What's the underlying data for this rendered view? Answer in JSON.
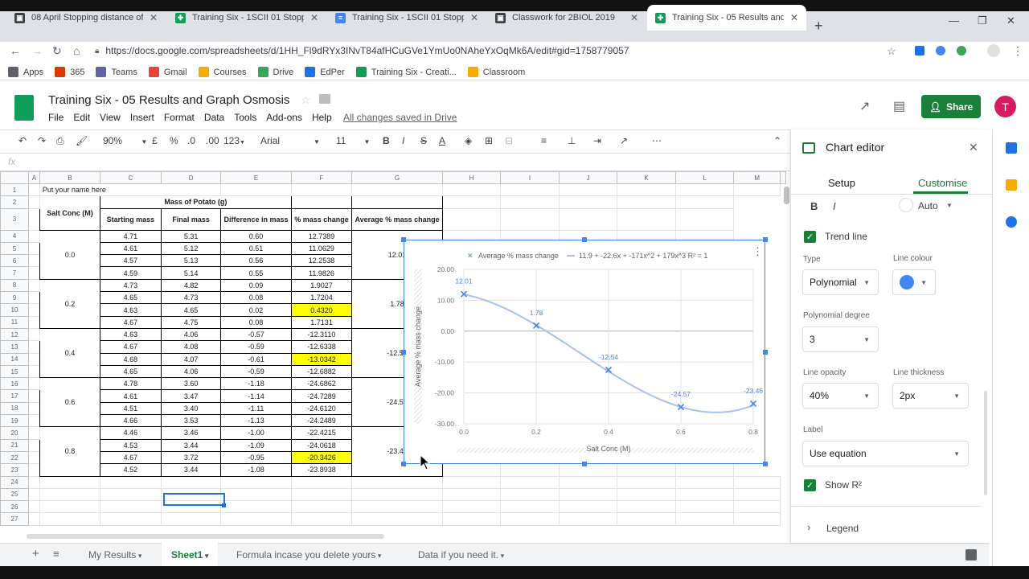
{
  "browser": {
    "tabs": [
      {
        "label": "08 April Stopping distance of a t",
        "color": "#3c4043",
        "glyph": "▣"
      },
      {
        "label": "Training Six - 1SCII 01 Stopping c",
        "color": "#0f9d58",
        "glyph": "✚"
      },
      {
        "label": "Training Six - 1SCII 01 Stopping c",
        "color": "#4285f4",
        "glyph": "≡"
      },
      {
        "label": "Classwork for 2BIOL 2019",
        "color": "#3c4043",
        "glyph": "▣"
      },
      {
        "label": "Training Six - 05 Results and Gra",
        "color": "#0f9d58",
        "glyph": "✚"
      }
    ],
    "url": "https://docs.google.com/spreadsheets/d/1HH_Fl9dRYx3INvT84afHCuGVe1YmUo0NAheYxOqMk6A/edit#gid=1758779057",
    "bookmarks": [
      {
        "label": "Apps",
        "color": "#5f6368"
      },
      {
        "label": "365",
        "color": "#d83b01"
      },
      {
        "label": "Teams",
        "color": "#6264a7"
      },
      {
        "label": "Gmail",
        "color": "#ea4335"
      },
      {
        "label": "Courses",
        "color": "#f9ab00"
      },
      {
        "label": "Drive",
        "color": "#34a853"
      },
      {
        "label": "EdPer",
        "color": "#1a73e8"
      },
      {
        "label": "Training Six - Creati...",
        "color": "#0f9d58"
      },
      {
        "label": "Classroom",
        "color": "#f9ab00"
      }
    ]
  },
  "doc": {
    "title": "Training Six - 05 Results and Graph Osmosis",
    "menu": [
      "File",
      "Edit",
      "View",
      "Insert",
      "Format",
      "Data",
      "Tools",
      "Add-ons",
      "Help"
    ],
    "saved": "All changes saved in Drive",
    "share": "Share",
    "avatar": "T"
  },
  "toolbar": {
    "zoom": "90%",
    "currency": "£",
    "percent": "%",
    "dec_less": ".0",
    "dec_more": ".00",
    "more_formats": "123",
    "font": "Arial",
    "size": "11",
    "bold": "B",
    "italic": "I",
    "strike": "S",
    "text_color": "A",
    "fx": "fx"
  },
  "sheet": {
    "col_headers": [
      "A",
      "B",
      "C",
      "D",
      "E",
      "F",
      "G",
      "H",
      "I",
      "J",
      "K",
      "L",
      "M"
    ],
    "a1": "Put your name here",
    "mass_header": "Mass of Potato (g)",
    "headers": [
      "Salt Conc (M)",
      "Starting mass",
      "Final mass",
      "Difference in mass",
      "% mass change",
      "Average % mass change"
    ],
    "groups": [
      {
        "conc": "0.0",
        "avg": "12.01",
        "rows": [
          [
            "4.71",
            "5.31",
            "0.60",
            "12.7389"
          ],
          [
            "4.61",
            "5.12",
            "0.51",
            "11.0629"
          ],
          [
            "4.57",
            "5.13",
            "0.56",
            "12.2538"
          ],
          [
            "4.59",
            "5.14",
            "0.55",
            "11.9826"
          ]
        ]
      },
      {
        "conc": "0.2",
        "avg": "1.78",
        "rows": [
          [
            "4.73",
            "4.82",
            "0.09",
            "1.9027"
          ],
          [
            "4.65",
            "4.73",
            "0.08",
            "1.7204"
          ],
          [
            "4.63",
            "4.65",
            "0.02",
            "0.4320"
          ],
          [
            "4.67",
            "4.75",
            "0.08",
            "1.7131"
          ]
        ]
      },
      {
        "conc": "0.4",
        "avg": "-12.54",
        "rows": [
          [
            "4.63",
            "4.06",
            "-0.57",
            "-12.3110"
          ],
          [
            "4.67",
            "4.08",
            "-0.59",
            "-12.6338"
          ],
          [
            "4.68",
            "4.07",
            "-0.61",
            "-13.0342"
          ],
          [
            "4.65",
            "4.06",
            "-0.59",
            "-12.6882"
          ]
        ]
      },
      {
        "conc": "0.6",
        "avg": "-24.57",
        "rows": [
          [
            "4.78",
            "3.60",
            "-1.18",
            "-24.6862"
          ],
          [
            "4.61",
            "3.47",
            "-1.14",
            "-24.7289"
          ],
          [
            "4.51",
            "3.40",
            "-1.11",
            "-24.6120"
          ],
          [
            "4.66",
            "3.53",
            "-1.13",
            "-24.2489"
          ]
        ]
      },
      {
        "conc": "0.8",
        "avg": "-23.46",
        "rows": [
          [
            "4.46",
            "3.46",
            "-1.00",
            "-22.4215"
          ],
          [
            "4.53",
            "3.44",
            "-1.09",
            "-24.0618"
          ],
          [
            "4.67",
            "3.72",
            "-0.95",
            "-20.3426"
          ],
          [
            "4.52",
            "3.44",
            "-1.08",
            "-23.8938"
          ]
        ]
      }
    ],
    "highlight_color": "#ffff00",
    "tabs": [
      "My Results",
      "Sheet1",
      "Formula incase you delete yours",
      "Data if you need it."
    ]
  },
  "chart_data": {
    "type": "scatter",
    "title": "",
    "legend": [
      "Average % mass change",
      "11.9 + -22.6x + -171x^2 + 179x^3 R² = 1"
    ],
    "legend_position": "top",
    "xlabel": "Salt Conc (M)",
    "ylabel": "Average % mass change",
    "x": [
      0.0,
      0.2,
      0.4,
      0.6,
      0.8
    ],
    "y": [
      12.01,
      1.78,
      -12.54,
      -24.57,
      -23.46
    ],
    "point_labels": [
      "12.01",
      "1.78",
      "-12.54",
      "-24.57",
      "-23.46"
    ],
    "trendline": {
      "type": "polynomial",
      "degree": 3,
      "coefficients": [
        11.9,
        -22.6,
        -171,
        179
      ],
      "r2": 1,
      "color": "#a4c2f4"
    },
    "xticks": [
      "0.0",
      "0.2",
      "0.4",
      "0.6",
      "0.8"
    ],
    "yticks": [
      "20.00",
      "10.00",
      "0.00",
      "-10.00",
      "-20.00",
      "-30.00"
    ],
    "xlim": [
      0,
      0.8
    ],
    "ylim": [
      -30,
      20
    ],
    "grid": true,
    "series_color": "#4285f4"
  },
  "editor": {
    "title": "Chart editor",
    "tabs": [
      "Setup",
      "Customise"
    ],
    "bold": "B",
    "italic": "I",
    "text_color_value": "Auto",
    "trendline_label": "Trend line",
    "type_label": "Type",
    "type_value": "Polynomial",
    "line_colour_label": "Line colour",
    "line_colour": "#4285f4",
    "degree_label": "Polynomial degree",
    "degree_value": "3",
    "opacity_label": "Line opacity",
    "opacity_value": "40%",
    "thickness_label": "Line thickness",
    "thickness_value": "2px",
    "label_label": "Label",
    "label_value": "Use equation",
    "show_r2": "Show R²",
    "legend_section": "Legend"
  }
}
